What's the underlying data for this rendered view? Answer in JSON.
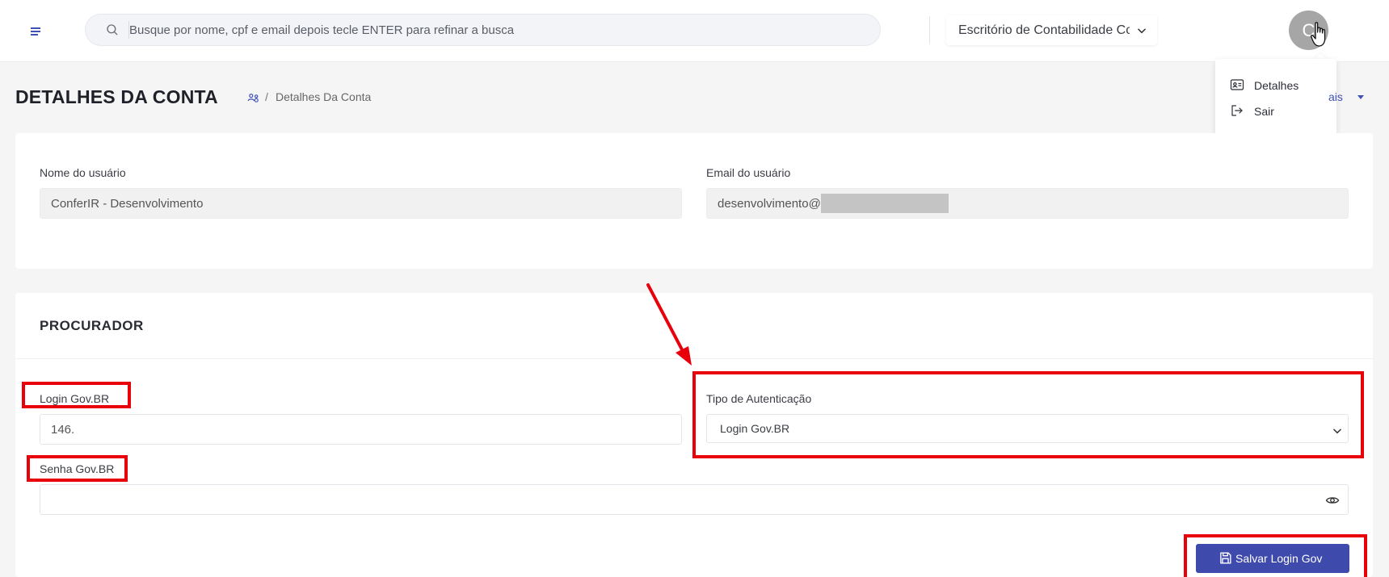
{
  "header": {
    "search_placeholder": "Busque por nome, cpf e email depois tecle ENTER para refinar a busca",
    "company_selector": "Escritório de Contabilidade Cc",
    "avatar_initial": "C",
    "user_menu": [
      {
        "label": "Detalhes",
        "icon": "id-card-icon"
      },
      {
        "label": "Sair",
        "icon": "logout-icon"
      }
    ]
  },
  "page": {
    "title": "DETALHES DA CONTA",
    "breadcrumb_separator": "/",
    "breadcrumb_current": "Detalhes Da Conta",
    "more_link": "ais"
  },
  "account": {
    "username_label": "Nome do usuário",
    "username_value": "ConferIR - Desenvolvimento",
    "email_label": "Email do usuário",
    "email_value": "desenvolvimento@"
  },
  "procurador": {
    "title": "PROCURADOR",
    "login_label": "Login Gov.BR",
    "login_value": "146.",
    "auth_label": "Tipo de Autenticação",
    "auth_value": "Login Gov.BR",
    "password_label": "Senha Gov.BR",
    "password_value": "",
    "save_button": "Salvar Login Gov"
  },
  "colors": {
    "accent": "#3f4aad",
    "annotation": "#e8000b"
  }
}
